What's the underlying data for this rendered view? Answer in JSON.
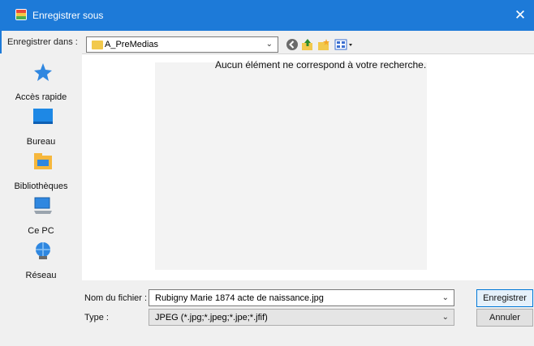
{
  "window": {
    "title": "Enregistrer sous",
    "close_label": "✕",
    "icons": {
      "app": "paint-app-icon"
    }
  },
  "toolbar": {
    "location_label": "Enregistrer dans :",
    "location_value": "A_PreMedias",
    "icons": [
      "back-icon",
      "up-folder-icon",
      "new-folder-icon",
      "view-menu-icon"
    ]
  },
  "places": [
    {
      "label": "Accès rapide",
      "icon": "pin-icon"
    },
    {
      "label": "Bureau",
      "icon": "desktop-icon"
    },
    {
      "label": "Bibliothèques",
      "icon": "libraries-icon"
    },
    {
      "label": "Ce PC",
      "icon": "computer-icon"
    },
    {
      "label": "Réseau",
      "icon": "network-icon"
    }
  ],
  "filelist": {
    "empty_message": "Aucun élément ne correspond à votre recherche."
  },
  "form": {
    "filename_label": "Nom du fichier :",
    "filename_value": "Rubigny Marie 1874 acte de naissance.jpg",
    "type_label": "Type :",
    "type_value": "JPEG (*.jpg;*.jpeg;*.jpe;*.jfif)"
  },
  "buttons": {
    "save": "Enregistrer",
    "cancel": "Annuler"
  },
  "colors": {
    "titlebar": "#1d7ad8",
    "accent": "#0078d7"
  }
}
